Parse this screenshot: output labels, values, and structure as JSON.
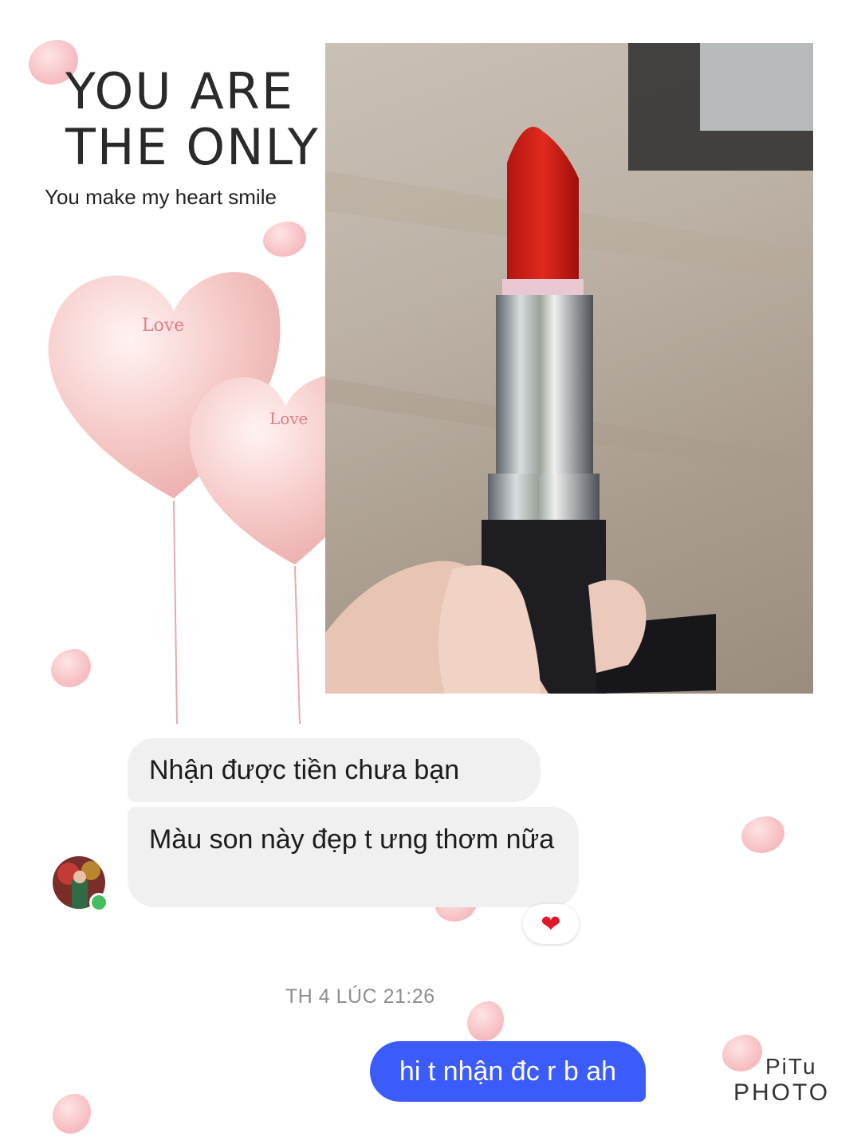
{
  "header": {
    "title_line1": "YOU ARE",
    "title_line2": "THE ONLY",
    "subtitle": "You make my heart smile"
  },
  "balloons": {
    "label": "Love"
  },
  "chat": {
    "incoming": [
      {
        "text": "Nhận được tiền chưa bạn"
      },
      {
        "text": "Màu son này đẹp t ưng thơm nữa"
      }
    ],
    "reaction": "heart-reaction",
    "timestamp": "TH 4 LÚC 21:26",
    "outgoing": [
      {
        "text": "hi t nhận đc r b ah"
      }
    ],
    "online_color": "#45bd62",
    "outgoing_color": "#3b5bfa"
  },
  "watermark": {
    "line1": "PiTu",
    "line2": "PHOTO"
  }
}
